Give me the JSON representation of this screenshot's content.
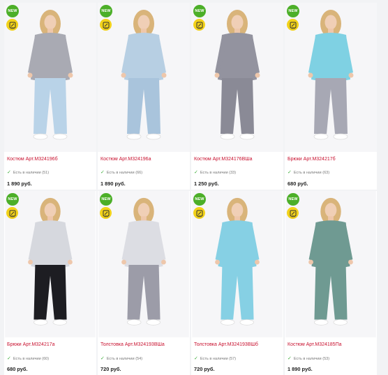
{
  "colors": {
    "new_badge": "#4caf28",
    "size_badge": "#f2d21a",
    "title_link": "#c8102e",
    "stock_check": "#3fae3c"
  },
  "products": [
    {
      "badge": "NEW",
      "size_icon": "scale-size-icon",
      "title": "Костюм Арт.М324196б",
      "stock": "Есть в наличии (51)",
      "price": "1 890 руб.",
      "garment": "#a9aab3",
      "accent": "#b9d3e8",
      "bg": "#f6f6f8"
    },
    {
      "badge": "NEW",
      "size_icon": "scale-size-icon",
      "title": "Костюм Арт.М324196а",
      "stock": "Есть в наличии (66)",
      "price": "1 890 руб.",
      "garment": "#b7cfe3",
      "accent": "#a9c4dc",
      "bg": "#f6f6f8"
    },
    {
      "badge": "NEW",
      "size_icon": "scale-size-icon",
      "title": "Костюм Арт.М324176ВШа",
      "stock": "Есть в наличии (33)",
      "price": "1 250 руб.",
      "garment": "#93939f",
      "accent": "#8a8a96",
      "bg": "#f6f6f8"
    },
    {
      "badge": "NEW",
      "size_icon": "scale-size-icon",
      "title": "Брюки Арт.М324217б",
      "stock": "Есть в наличии (63)",
      "price": "680 руб.",
      "garment": "#7fd1e3",
      "accent": "#a7a8b4",
      "bg": "#f6f6f8"
    },
    {
      "badge": "NEW",
      "size_icon": "scale-size-icon",
      "title": "Брюки Арт.М324217а",
      "stock": "Есть в наличии (60)",
      "price": "680 руб.",
      "garment": "#d6d8de",
      "accent": "#1d1d22",
      "bg": "#f6f6f8"
    },
    {
      "badge": "NEW",
      "size_icon": "scale-size-icon",
      "title": "Толстовка Арт.М324193ВШа",
      "stock": "Есть в наличии (54)",
      "price": "720 руб.",
      "garment": "#dcdde3",
      "accent": "#9c9ca8",
      "bg": "#f6f6f8"
    },
    {
      "badge": "NEW",
      "size_icon": "scale-size-icon",
      "title": "Толстовка Арт.М324193ВШб",
      "stock": "Есть в наличии (57)",
      "price": "720 руб.",
      "garment": "#86d0e4",
      "accent": "#86d0e4",
      "bg": "#f6f6f8"
    },
    {
      "badge": "NEW",
      "size_icon": "scale-size-icon",
      "title": "Костюм Арт.М324185Па",
      "stock": "Есть в наличии (53)",
      "price": "1 890 руб.",
      "garment": "#6f9a92",
      "accent": "#6f9a92",
      "bg": "#f6f6f8"
    }
  ]
}
